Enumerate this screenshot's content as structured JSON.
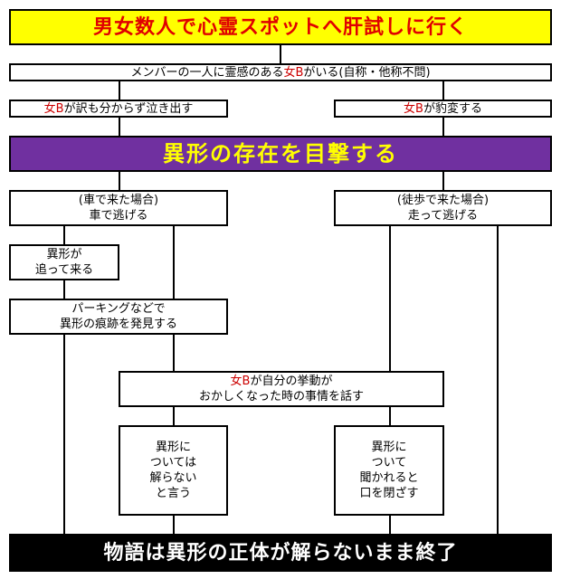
{
  "title": "男女数人で心霊スポットへ肝試しに行く",
  "member": {
    "before": "メンバーの一人に霊感のある",
    "highlight": "女B",
    "after": "がいる(自称・他称不問)"
  },
  "cry": {
    "highlight": "女B",
    "after": "が訳も分からず泣き出す"
  },
  "transform": {
    "highlight": "女B",
    "after": "が豹変する"
  },
  "witness": "異形の存在を目撃する",
  "car": {
    "line1": "(車で来た場合)",
    "line2": "車で逃げる"
  },
  "foot": {
    "line1": "(徒歩で来た場合)",
    "line2": "走って逃げる"
  },
  "chase": {
    "line1": "異形が",
    "line2": "追って来る"
  },
  "parking": {
    "line1": "パーキングなどで",
    "line2": "異形の痕跡を発見する"
  },
  "explain": {
    "highlight": "女B",
    "line1_after": "が自分の挙動が",
    "line2": "おかしくなった時の事情を話す"
  },
  "unknown": {
    "line1": "異形に",
    "line2": "ついては",
    "line3": "解らない",
    "line4": "と言う"
  },
  "silent": {
    "line1": "異形に",
    "line2": "ついて",
    "line3": "聞かれると",
    "line4": "口を閉ざす"
  },
  "ending": "物語は異形の正体が解らないまま終了",
  "colors": {
    "title_bg": "#ffff00",
    "title_text": "#e00000",
    "witness_bg": "#7030a0",
    "witness_text": "#ffff00",
    "highlight": "#cc0000",
    "end_bg": "#000000"
  }
}
